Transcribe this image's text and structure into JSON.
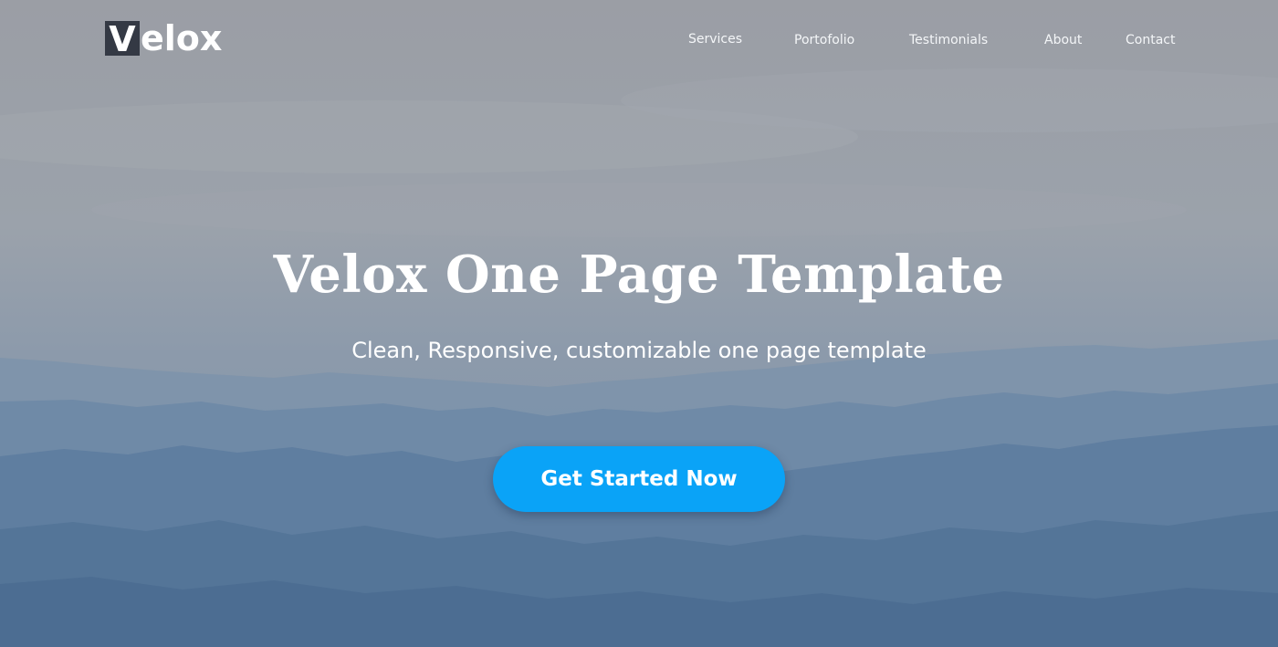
{
  "header": {
    "logo": {
      "highlighted_letter": "V",
      "rest": "elox"
    },
    "nav": [
      {
        "label": "Services"
      },
      {
        "label": "Portofolio"
      },
      {
        "label": "Testimonials"
      },
      {
        "label": "About"
      },
      {
        "label": "Contact"
      }
    ]
  },
  "hero": {
    "title": "Velox One Page Template",
    "subtitle": "Clean, Responsive, customizable one page template",
    "cta_label": "Get Started Now",
    "background": "mountain-landscape-photo"
  },
  "colors": {
    "accent": "#0aa3f7",
    "logo_box": "#343944",
    "text": "#ffffff"
  }
}
